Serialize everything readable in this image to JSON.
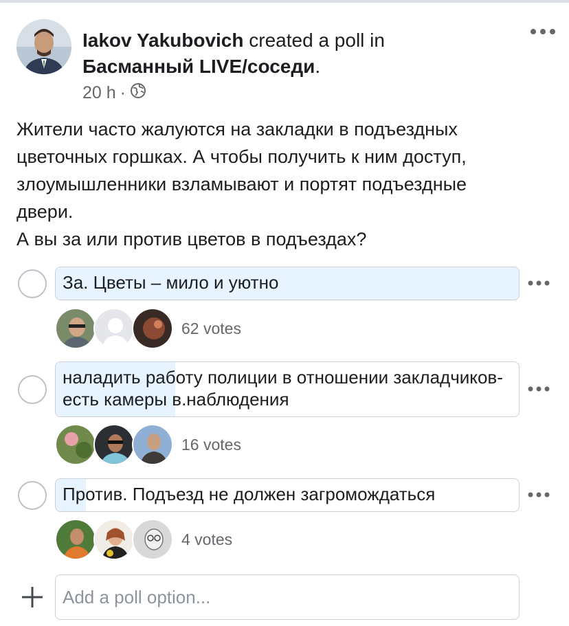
{
  "post": {
    "author": "Iakov Yakubovich",
    "action": " created a poll in",
    "group": "Басманный LIVE/соседи",
    "group_suffix": ".",
    "time": "20 h",
    "separator": "·",
    "privacy_icon": "globe-icon",
    "text_lines": [
      "Жители часто жалуются на закладки в подъездных",
      "цветочных горшках. А чтобы получить к ним доступ,",
      "злоумышленники взламывают и портят подъездные",
      "двери.",
      "А вы за или против цветов в подъездах?"
    ]
  },
  "poll": {
    "options": [
      {
        "label": "За. Цветы – мило и уютно",
        "votes_text": "62 votes",
        "share": 1.0,
        "voters": [
          "voter-avatar-1",
          "voter-avatar-2",
          "voter-avatar-3"
        ]
      },
      {
        "label": "наладить работу полиции в отношении закладчиков-есть камеры в.наблюдения",
        "votes_text": "16 votes",
        "share": 0.258,
        "voters": [
          "voter-avatar-4",
          "voter-avatar-5",
          "voter-avatar-6"
        ]
      },
      {
        "label": "Против. Подъезд не должен загромождаться",
        "votes_text": "4 votes",
        "share": 0.065,
        "voters": [
          "voter-avatar-7",
          "voter-avatar-8",
          "voter-avatar-9"
        ]
      }
    ],
    "add_option_placeholder": "Add a poll option..."
  },
  "colors": {
    "fill": "#e7f3ff",
    "secondary_text": "#65676b",
    "border": "#ccd0d5"
  }
}
